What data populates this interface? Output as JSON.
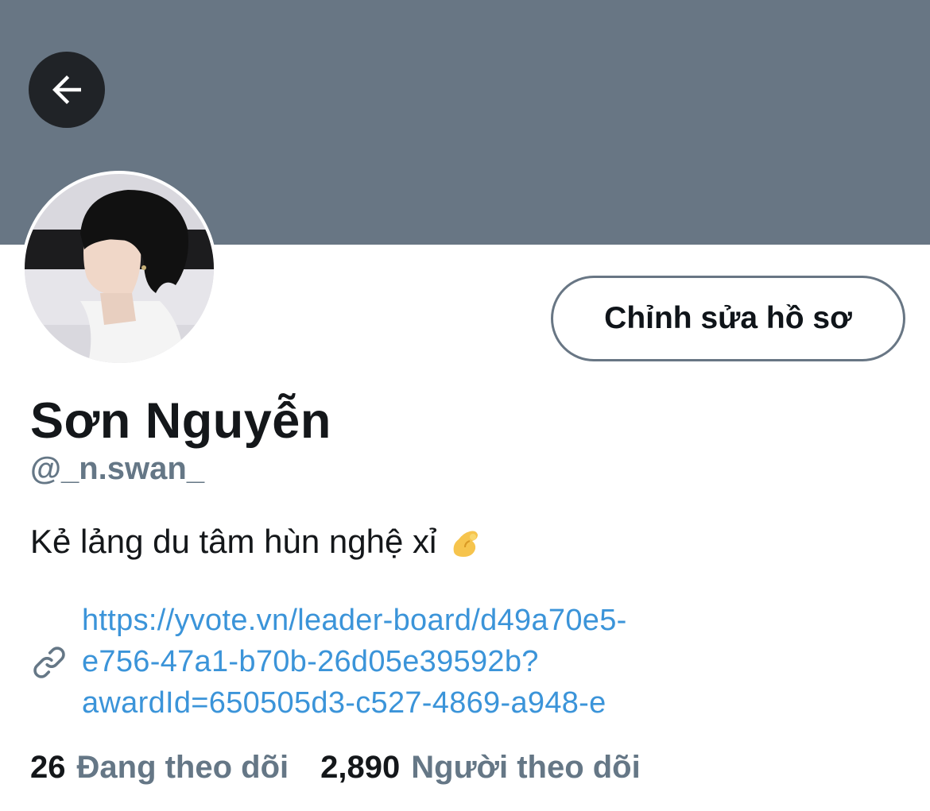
{
  "header": {
    "back_icon": "arrow-left-icon",
    "banner_color": "#687684"
  },
  "profile": {
    "display_name": "Sơn Nguyễn",
    "handle": "@_n.swan_",
    "bio": "Kẻ lảng du tâm hùn nghệ xỉ",
    "bio_emoji": "pinching-hand-emoji",
    "edit_button_label": "Chỉnh sửa hồ sơ",
    "link_icon": "link-icon",
    "link_lines": [
      "https://yvote.vn/leader-board/d49a70e5-",
      "e756-47a1-b70b-26d05e39592b?",
      "awardId=650505d3-c527-4869-a948-e"
    ],
    "link_color": "#3b94d9"
  },
  "stats": {
    "following_count": "26",
    "following_label": "Đang theo dõi",
    "followers_count": "2,890",
    "followers_label": "Người theo dõi"
  }
}
